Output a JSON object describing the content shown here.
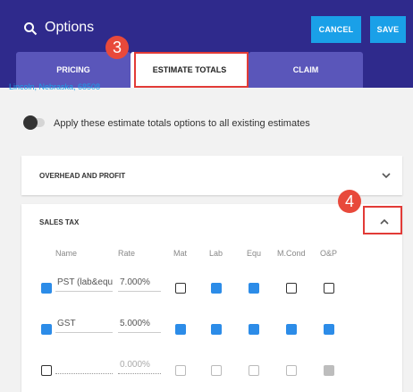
{
  "header": {
    "title": "Options",
    "cancel_label": "CANCEL",
    "save_label": "SAVE"
  },
  "tabs": [
    {
      "label": "PRICING"
    },
    {
      "label": "ESTIMATE TOTALS"
    },
    {
      "label": "CLAIM"
    }
  ],
  "annotations": {
    "badge1": "3",
    "badge2": "4"
  },
  "address": "Lincoln, Nebraska, 68508",
  "toggle_label": "Apply these estimate totals options to all existing estimates",
  "panels": {
    "overhead_title": "OVERHEAD AND PROFIT",
    "sales_title": "SALES TAX"
  },
  "sales_table": {
    "columns": [
      "Name",
      "Rate",
      "Mat",
      "Lab",
      "Equ",
      "M.Cond",
      "O&P"
    ],
    "rows": [
      {
        "selected": true,
        "name": "PST (lab&equ",
        "rate": "7.000%",
        "mat": false,
        "lab": true,
        "equ": true,
        "mcond": false,
        "op": false
      },
      {
        "selected": true,
        "name": "GST",
        "rate": "5.000%",
        "mat": true,
        "lab": true,
        "equ": true,
        "mcond": true,
        "op": true
      },
      {
        "selected": false,
        "name": "",
        "rate": "0.000%",
        "mat": false,
        "lab": false,
        "equ": false,
        "mcond": false,
        "op": true
      }
    ]
  },
  "colors": {
    "header": "#2f2a8c",
    "tab": "#5a56ba",
    "accent": "#1aa0e8",
    "highlight": "#e23b37"
  }
}
